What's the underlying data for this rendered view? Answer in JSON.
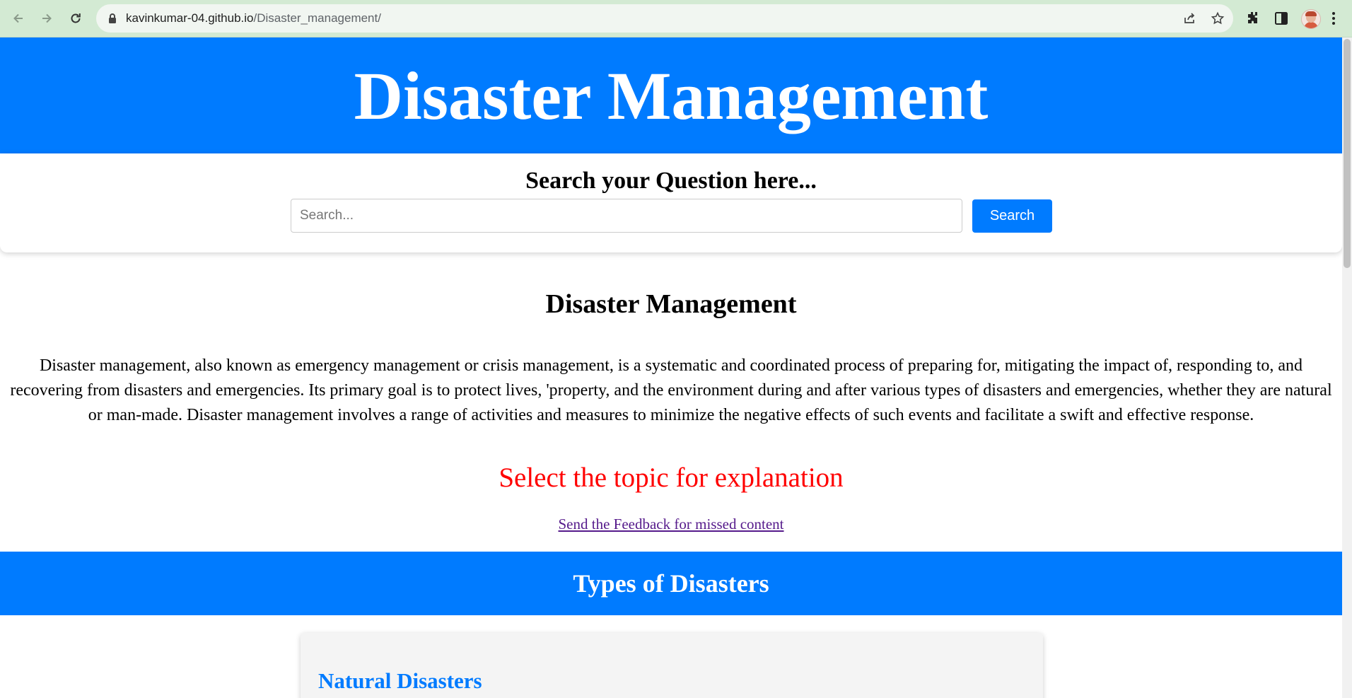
{
  "browser": {
    "url_host": "kavinkumar-04.github.io",
    "url_path": "/Disaster_management/"
  },
  "header": {
    "title": "Disaster Management"
  },
  "search": {
    "heading": "Search your Question here...",
    "placeholder": "Search...",
    "value": "",
    "button_label": "Search"
  },
  "intro": {
    "heading": "Disaster Management",
    "text": "Disaster management, also known as emergency management or crisis management, is a systematic and coordinated process of preparing for, mitigating the impact of, responding to, and recovering from disasters and emergencies. Its primary goal is to protect lives, 'property, and the environment during and after various types of disasters and emergencies, whether they are natural or man-made. Disaster management involves a range of activities and measures to minimize the negative effects of such events and facilitate a swift and effective response."
  },
  "topic_prompt": "Select the topic for explanation",
  "feedback_link": "Send the Feedback for missed content",
  "types_section": {
    "heading": "Types of Disasters",
    "card_title": "Natural Disasters"
  },
  "colors": {
    "accent": "#007bff",
    "prompt_red": "#ff0000",
    "visited_link": "#551a8b"
  }
}
